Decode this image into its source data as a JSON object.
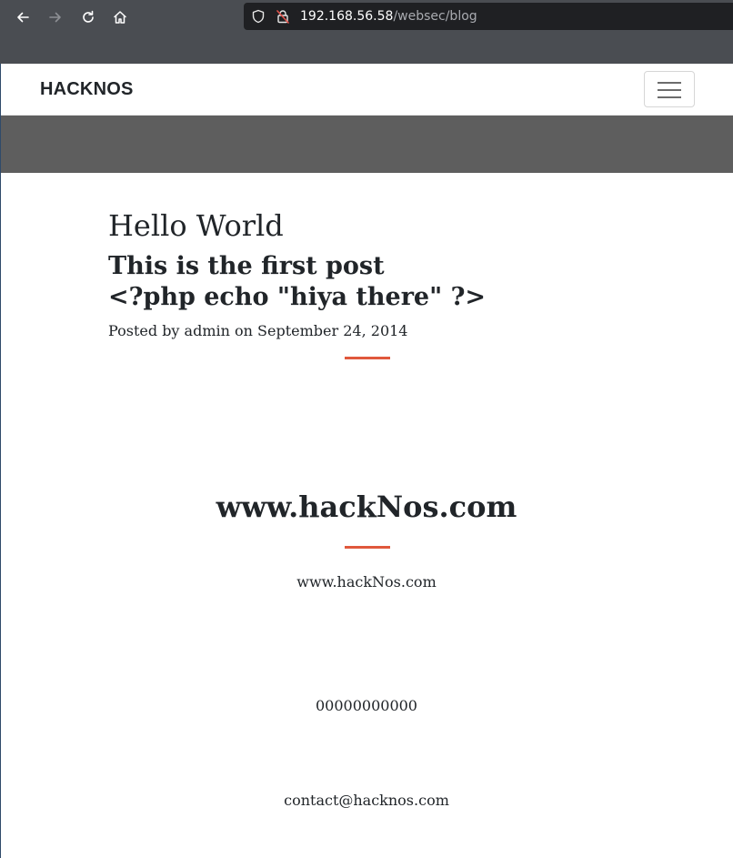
{
  "browser": {
    "back_icon": "arrow-left-icon",
    "forward_icon": "arrow-right-icon",
    "reload_icon": "reload-icon",
    "home_icon": "home-icon",
    "url_host": "192.168.56.58",
    "url_path": "/websec/blog"
  },
  "navbar": {
    "brand": "HACKNOS",
    "toggler_icon": "hamburger-menu-icon"
  },
  "post": {
    "title": "Hello World",
    "subtitle": "This is the first post\n<?php echo \"hiya there\" ?>",
    "meta": "Posted by admin on September 24, 2014"
  },
  "contact": {
    "heading": "www.hackNos.com",
    "website": "www.hackNos.com",
    "phone": "00000000000",
    "email": "contact@hacknos.com"
  },
  "colors": {
    "accent_divider": "#e0583c",
    "masthead": "#5e5e5e",
    "chrome": "#4a4d52"
  }
}
